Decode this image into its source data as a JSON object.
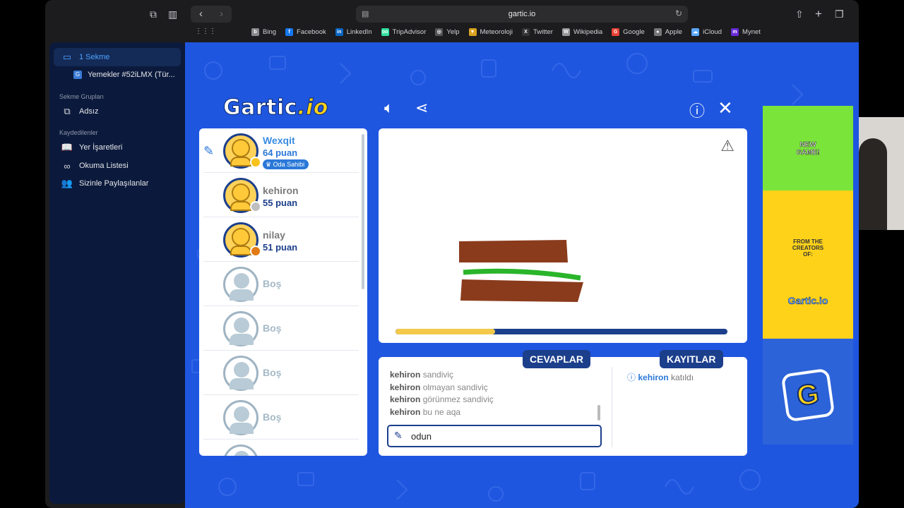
{
  "browser": {
    "url": "gartic.io",
    "bookmarks": [
      {
        "label": "Bing",
        "color": "#8a8a8e",
        "glyph": "b"
      },
      {
        "label": "Facebook",
        "color": "#1877f2",
        "glyph": "f"
      },
      {
        "label": "LinkedIn",
        "color": "#0a66c2",
        "glyph": "in"
      },
      {
        "label": "TripAdvisor",
        "color": "#34e0a1",
        "glyph": "oo"
      },
      {
        "label": "Yelp",
        "color": "#555",
        "glyph": "◎"
      },
      {
        "label": "Meteoroloji",
        "color": "#d9a321",
        "glyph": "▼"
      },
      {
        "label": "Twitter",
        "color": "#333",
        "glyph": "X"
      },
      {
        "label": "Wikipedia",
        "color": "#999",
        "glyph": "W"
      },
      {
        "label": "Google",
        "color": "#ea4335",
        "glyph": "G"
      },
      {
        "label": "Apple",
        "color": "#777",
        "glyph": "●"
      },
      {
        "label": "iCloud",
        "color": "#5aa9ff",
        "glyph": "☁"
      },
      {
        "label": "Mynet",
        "color": "#6a2bd8",
        "glyph": "m"
      }
    ]
  },
  "sidebar": {
    "tabs_label": "1 Sekme",
    "tab_title": "Yemekler #52iLMX (Tür...",
    "groups_header": "Sekme Grupları",
    "group_item": "Adsız",
    "saved_header": "Kaydedilenler",
    "saved_items": [
      "Yer İşaretleri",
      "Okuma Listesi",
      "Sizinle Paylaşılanlar"
    ]
  },
  "game": {
    "logo_main": "Gartic",
    "logo_suffix": ".io",
    "players": [
      {
        "name": "Wexqit",
        "score": "64 puan",
        "badge": "Oda Sahibi",
        "dot": "#f7c31c"
      },
      {
        "name": "kehiron",
        "score": "55 puan",
        "dot": "#bfbfbf"
      },
      {
        "name": "nilay",
        "score": "51 puan",
        "dot": "#e27a15"
      }
    ],
    "empty_label": "Boş",
    "progress": 0.3,
    "answers_tab": "CEVAPLAR",
    "logs_tab": "KAYITLAR",
    "answers": [
      {
        "user": "kehiron",
        "text": "sandiviç"
      },
      {
        "user": "kehiron",
        "text": "olmayan sandiviç"
      },
      {
        "user": "kehiron",
        "text": "görünmez sandiviç"
      },
      {
        "user": "kehiron",
        "text": "bu ne aqa"
      }
    ],
    "input_value": "odun",
    "log": {
      "user": "kehiron",
      "text": "katıldı"
    }
  },
  "ad": {
    "line1": "NEW GAME!",
    "line2": "FROM THE CREATORS OF:",
    "logo": "Gartic.io",
    "icon_letter": "G"
  }
}
